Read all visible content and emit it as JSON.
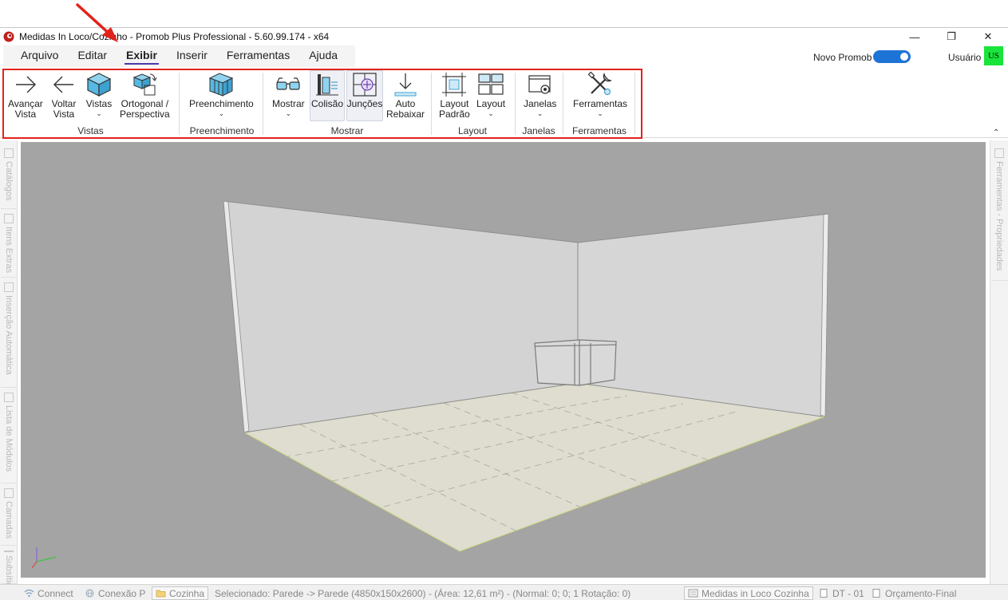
{
  "window": {
    "title": "Medidas In Loco/Cozinho - Promob Plus Professional - 5.60.99.174 - x64",
    "minimize_symbol": "—",
    "restore_symbol": "❐",
    "close_symbol": "✕"
  },
  "menu": {
    "tabs": [
      {
        "label": "Arquivo",
        "active": false
      },
      {
        "label": "Editar",
        "active": false
      },
      {
        "label": "Exibir",
        "active": true
      },
      {
        "label": "Inserir",
        "active": false
      },
      {
        "label": "Ferramentas",
        "active": false
      },
      {
        "label": "Ajuda",
        "active": false
      }
    ],
    "novo_promob_label": "Novo Promob",
    "novo_promob_enabled": true,
    "usuario_label": "Usuário",
    "user_initials": "US"
  },
  "ribbon": {
    "buttons": {
      "avancar_vista": {
        "line1": "Avançar",
        "line2": "Vista"
      },
      "voltar_vista": {
        "line1": "Voltar",
        "line2": "Vista"
      },
      "vistas": {
        "line1": "Vistas"
      },
      "ortogonal": {
        "line1": "Ortogonal /",
        "line2": "Perspectiva"
      },
      "preenchimento": {
        "line1": "Preenchimento"
      },
      "mostrar": {
        "line1": "Mostrar"
      },
      "colisao": {
        "line1": "Colisão"
      },
      "juncoes": {
        "line1": "Junções"
      },
      "auto_rebaixar": {
        "line1": "Auto",
        "line2": "Rebaixar"
      },
      "layout_padrao": {
        "line1": "Layout",
        "line2": "Padrão"
      },
      "layout": {
        "line1": "Layout"
      },
      "janelas": {
        "line1": "Janelas"
      },
      "ferramentas": {
        "line1": "Ferramentas"
      }
    },
    "groups": {
      "vistas": "Vistas",
      "preenchimento": "Preenchimento",
      "mostrar": "Mostrar",
      "layout": "Layout",
      "janelas": "Janelas",
      "ferramentas": "Ferramentas"
    },
    "chevron": "⌄",
    "collapse_symbol": "⌃"
  },
  "left_panel": {
    "tabs": [
      "Catálogos",
      "Itens Extras",
      "Inserção Automática",
      "Lista de Módulos",
      "Camadas",
      "Subsítio"
    ]
  },
  "right_panel": {
    "tabs": [
      "Ferramentas - Propriedades"
    ]
  },
  "status": {
    "connect": "Connect",
    "conexao": "Conexão P",
    "ambiente": "Cozinha",
    "selection": "Selecionado: Parede -> Parede (4850x150x2600) - (Área: 12,61 m²) - (Normal: 0; 0; 1 Rotação: 0)",
    "project": "Medidas in Loco Cozinha",
    "dt": "DT - 01",
    "orcamento": "Orçamento-Final"
  },
  "colors": {
    "highlight_red": "#e2231a",
    "toggle_blue": "#1e73d6",
    "avatar_green": "#19e43a",
    "viewport_gray": "#a4a4a4",
    "active_tab_underline": "#4a3aa8"
  }
}
